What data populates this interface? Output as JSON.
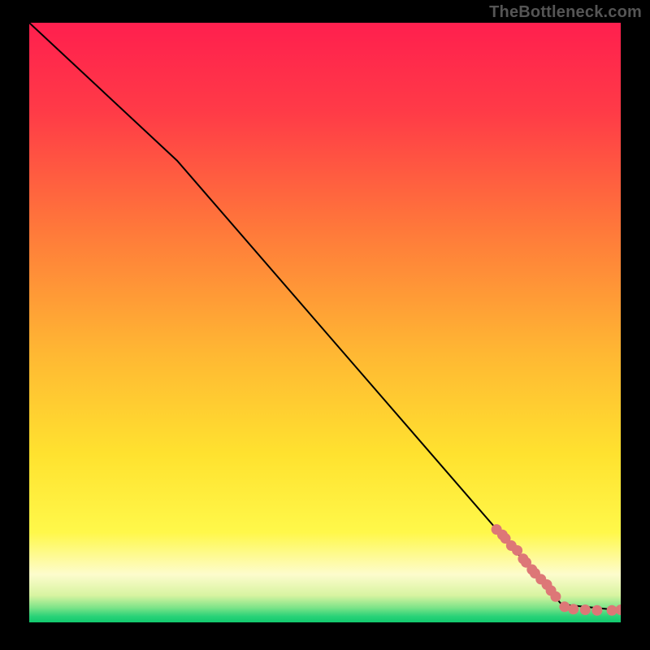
{
  "watermark": "TheBottleneck.com",
  "chart_data": {
    "type": "line",
    "title": "",
    "xlabel": "",
    "ylabel": "",
    "xlim": [
      0,
      100
    ],
    "ylim": [
      0,
      100
    ],
    "series": [
      {
        "name": "curve",
        "x": [
          0,
          25,
          90,
          100
        ],
        "y": [
          100,
          77,
          3,
          2
        ],
        "color": "#000000"
      }
    ],
    "points": {
      "name": "markers",
      "color": "#dd7777",
      "radius_px": 6.5,
      "x": [
        79,
        80,
        80.5,
        81.5,
        82.5,
        83.5,
        84,
        85,
        85.5,
        86.5,
        87.5,
        88.2,
        89,
        90.5,
        92,
        94,
        96,
        98.5,
        100
      ],
      "y": [
        15.5,
        14.6,
        14.0,
        12.8,
        12.0,
        10.6,
        10.0,
        8.8,
        8.2,
        7.2,
        6.3,
        5.3,
        4.3,
        2.6,
        2.2,
        2.1,
        2.0,
        2.0,
        2.1
      ]
    },
    "background_gradient": {
      "stops": [
        {
          "offset": 0.0,
          "color": "#ff1f4e"
        },
        {
          "offset": 0.15,
          "color": "#ff3b47"
        },
        {
          "offset": 0.35,
          "color": "#ff7a3a"
        },
        {
          "offset": 0.55,
          "color": "#ffb733"
        },
        {
          "offset": 0.72,
          "color": "#ffe22f"
        },
        {
          "offset": 0.85,
          "color": "#fff84a"
        },
        {
          "offset": 0.92,
          "color": "#fdfccd"
        },
        {
          "offset": 0.955,
          "color": "#d8f4a1"
        },
        {
          "offset": 0.975,
          "color": "#7fe489"
        },
        {
          "offset": 0.99,
          "color": "#29d278"
        },
        {
          "offset": 1.0,
          "color": "#11c96e"
        }
      ]
    }
  }
}
